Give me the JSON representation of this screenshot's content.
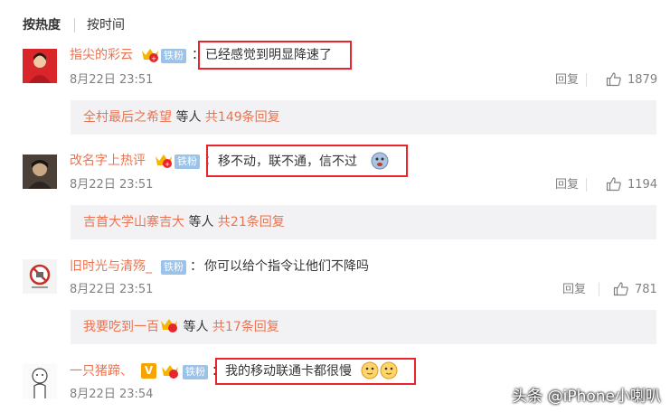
{
  "sort": {
    "hot": "按热度",
    "time": "按时间"
  },
  "comments": [
    {
      "username": "指尖的彩云",
      "fan_badge": "铁粉",
      "text": "已经感觉到明显降速了",
      "time": "8月22日 23:51",
      "reply_label": "回复",
      "likes": "1879",
      "sub_thread": {
        "users": "全村最后之希望",
        "suffix": " 等人 ",
        "count": "共149条回复"
      }
    },
    {
      "username": "改名字上热评",
      "fan_badge": "铁粉",
      "text": "移不动，联不通，信不过",
      "time": "8月22日 23:51",
      "reply_label": "回复",
      "likes": "1194",
      "sub_thread": {
        "users": "吉首大学山寨吉大",
        "suffix": " 等人 ",
        "count": "共21条回复"
      }
    },
    {
      "username": "旧时光与清殇_",
      "fan_badge": "铁粉",
      "text": "你可以给个指令让他们不降吗",
      "time": "8月22日 23:51",
      "reply_label": "回复",
      "likes": "781",
      "sub_thread": {
        "users": "我要吃到一百",
        "suffix": " 等人 ",
        "count": "共17条回复"
      }
    },
    {
      "username": "一只猪蹄、",
      "fan_badge": "铁粉",
      "vip_badge": "V",
      "text": "我的移动联通卡都很慢",
      "time": "8月22日 23:54"
    }
  ],
  "watermark": "头条 @iPhone小喇叭",
  "colors": {
    "username": "#eb7350",
    "fan_badge": "#9bc2e8",
    "highlight_box": "#e8252b",
    "sub_bg": "#f2f2f5"
  }
}
